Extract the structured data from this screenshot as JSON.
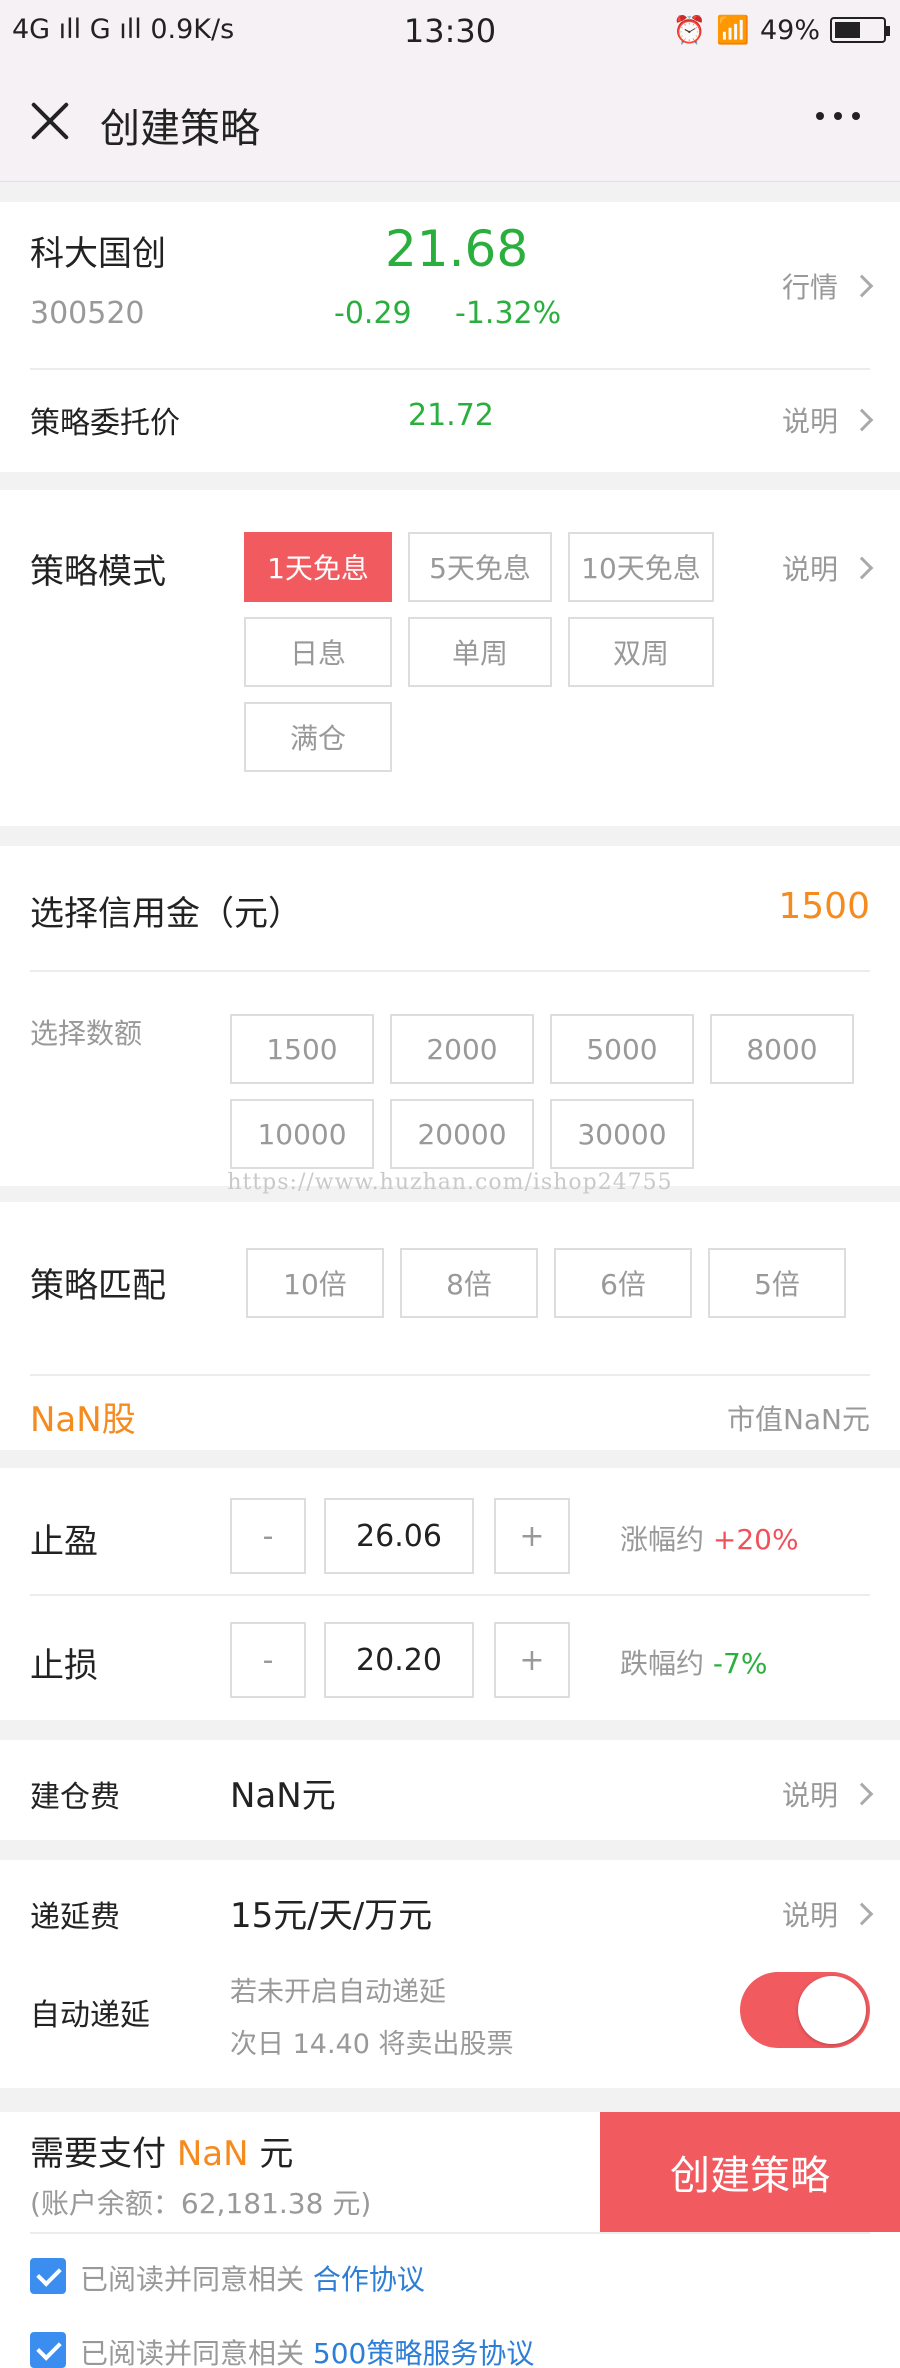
{
  "status_bar": {
    "network": "4G ıll  G ıll  0.9K/s",
    "time": "13:30",
    "battery": "49%"
  },
  "nav": {
    "title": "创建策略"
  },
  "stock": {
    "name": "科大国创",
    "code": "300520",
    "price": "21.68",
    "change": "-0.29",
    "change_pct": "-1.32%",
    "quote_link": "行情"
  },
  "entrust": {
    "label": "策略委托价",
    "value": "21.72",
    "link": "说明"
  },
  "mode": {
    "label": "策略模式",
    "link": "说明",
    "options": [
      "1天免息",
      "5天免息",
      "10天免息",
      "日息",
      "单周",
      "双周",
      "满仓"
    ]
  },
  "credit": {
    "label": "选择信用金（元）",
    "value": "1500",
    "sub_label": "选择数额",
    "options": [
      "1500",
      "2000",
      "5000",
      "8000",
      "10000",
      "20000",
      "30000"
    ]
  },
  "watermark": "https://www.huzhan.com/ishop24755",
  "match": {
    "label": "策略匹配",
    "options": [
      "10倍",
      "8倍",
      "6倍",
      "5倍"
    ]
  },
  "shares": {
    "count": "NaN股",
    "market_value": "市值NaN元"
  },
  "take_profit": {
    "label": "止盈",
    "minus": "-",
    "value": "26.06",
    "plus": "+",
    "range_label": "涨幅约 ",
    "range_value": "+20%"
  },
  "stop_loss": {
    "label": "止损",
    "minus": "-",
    "value": "20.20",
    "plus": "+",
    "range_label": "跌幅约 ",
    "range_value": "-7%"
  },
  "position_fee": {
    "label": "建仓费",
    "value": "NaN元",
    "link": "说明"
  },
  "deferral_fee": {
    "label": "递延费",
    "value": "15元/天/万元",
    "link": "说明"
  },
  "auto_defer": {
    "label": "自动递延",
    "hint_line1": "若未开启自动递延",
    "hint_line2": "次日 14.40 将卖出股票",
    "enabled": true
  },
  "payment": {
    "prefix": "需要支付 ",
    "amount": "NaN",
    "suffix": " 元",
    "balance": "(账户余额：62,181.38 元)",
    "create_button": "创建策略"
  },
  "agreements": [
    {
      "text": "已阅读并同意相关 ",
      "link": "合作协议",
      "checked": true
    },
    {
      "text": "已阅读并同意相关 ",
      "link": "500策略服务协议",
      "checked": true
    }
  ]
}
